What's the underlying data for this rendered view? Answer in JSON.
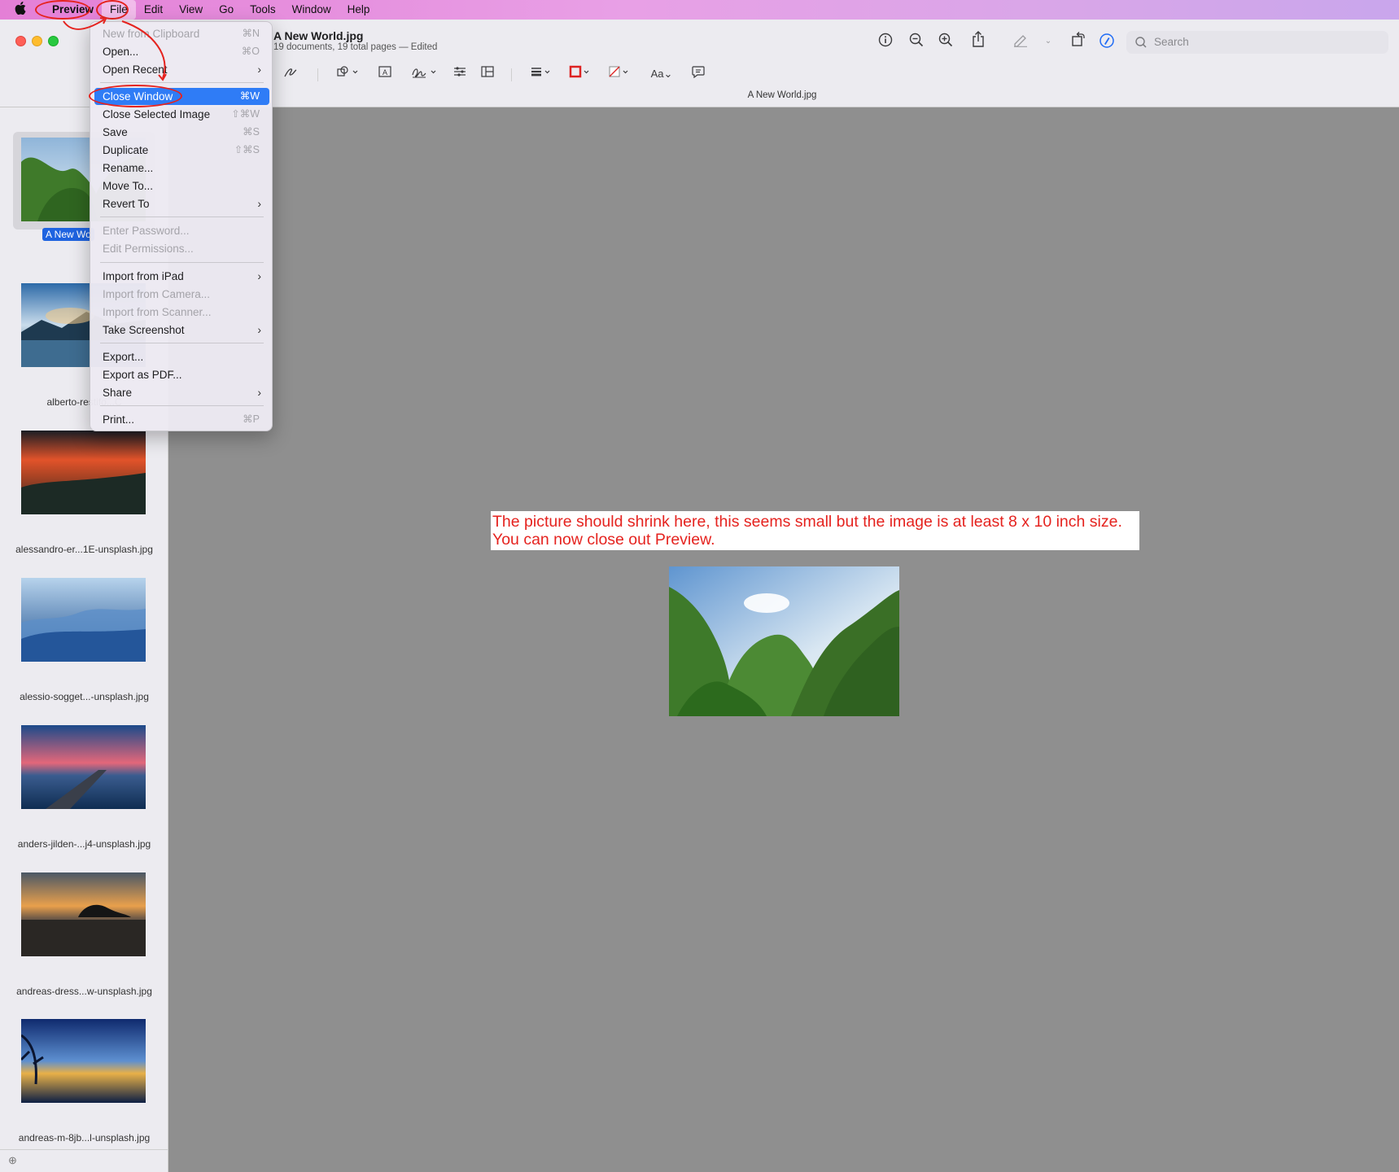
{
  "menubar": {
    "apple": "",
    "items": [
      "Preview",
      "File",
      "Edit",
      "View",
      "Go",
      "Tools",
      "Window",
      "Help"
    ]
  },
  "document": {
    "title": "A New World.jpg",
    "subtitle": "19 documents, 19 total pages — Edited",
    "tab_title": "A New World.jpg"
  },
  "search": {
    "placeholder": "Search"
  },
  "toolbar": {
    "icons": [
      "info-icon",
      "zoom-out-icon",
      "zoom-in-icon",
      "share-icon",
      "markup-pen-icon",
      "rotate-icon",
      "markup-toolbar-icon"
    ],
    "markup_icons": [
      "sketch-icon",
      "shapes-icon",
      "text-box-icon",
      "sign-icon",
      "adjust-color-icon",
      "adjust-size-icon",
      "border-style-icon",
      "border-color-icon",
      "fill-color-icon",
      "text-style-icon",
      "note-icon"
    ]
  },
  "file_menu": {
    "items": [
      {
        "label": "New from Clipboard",
        "shortcut": "⌘N",
        "disabled": true
      },
      {
        "label": "Open...",
        "shortcut": "⌘O"
      },
      {
        "label": "Open Recent",
        "submenu": true
      },
      {
        "label": "Close Window",
        "shortcut": "⌘W",
        "highlighted": true
      },
      {
        "label": "Close Selected Image",
        "shortcut": "⇧⌘W"
      },
      {
        "label": "Save",
        "shortcut": "⌘S"
      },
      {
        "label": "Duplicate",
        "shortcut": "⇧⌘S"
      },
      {
        "label": "Rename..."
      },
      {
        "label": "Move To..."
      },
      {
        "label": "Revert To",
        "submenu": true
      },
      {
        "label": "Enter Password...",
        "disabled": true
      },
      {
        "label": "Edit Permissions...",
        "disabled": true
      },
      {
        "label": "Import from iPad",
        "submenu": true
      },
      {
        "label": "Import from Camera...",
        "disabled": true
      },
      {
        "label": "Import from Scanner...",
        "disabled": true
      },
      {
        "label": "Take Screenshot",
        "submenu": true
      },
      {
        "label": "Export..."
      },
      {
        "label": "Export as PDF..."
      },
      {
        "label": "Share",
        "submenu": true
      },
      {
        "label": "Print...",
        "shortcut": "⌘P"
      }
    ]
  },
  "sidebar": {
    "selected_label": "A New Wo",
    "items": [
      {
        "label": "A New World.jpg"
      },
      {
        "label": "alberto-restifo...C"
      },
      {
        "label": "alessandro-er...1E-unsplash.jpg"
      },
      {
        "label": "alessio-sogget...-unsplash.jpg"
      },
      {
        "label": "anders-jilden-...j4-unsplash.jpg"
      },
      {
        "label": "andreas-dress...w-unsplash.jpg"
      },
      {
        "label": "andreas-m-8jb...l-unsplash.jpg"
      }
    ]
  },
  "annotation": {
    "line1": "The picture should shrink here, this seems small but the image is at least 8 x 10 inch size.",
    "line2": "You can now close out Preview.",
    "color": "#e5231f"
  }
}
